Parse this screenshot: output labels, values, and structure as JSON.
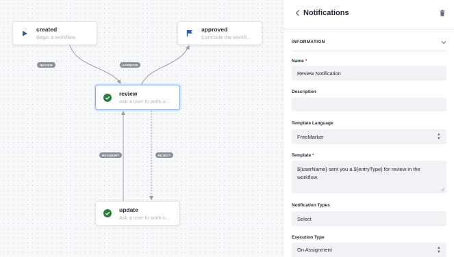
{
  "canvas": {
    "nodes": [
      {
        "id": "created",
        "title": "created",
        "description": "Begin a workflow.",
        "icon": "play-icon",
        "icon_color": "#2e5aac"
      },
      {
        "id": "approved",
        "title": "approved",
        "description": "Conclude the workfl...",
        "icon": "flag-icon",
        "icon_color": "#2e5aac"
      },
      {
        "id": "review",
        "title": "review",
        "description": "Ask a user to work o...",
        "icon": "check-circle-icon",
        "icon_color": "#287d3c"
      },
      {
        "id": "update",
        "title": "update",
        "description": "Ask a user to work o...",
        "icon": "check-circle-icon",
        "icon_color": "#287d3c"
      }
    ],
    "transitions": [
      {
        "label": "REVIEW",
        "from": "created",
        "to": "review"
      },
      {
        "label": "APPROVE",
        "from": "review",
        "to": "approved"
      },
      {
        "label": "RESUBMIT",
        "from": "update",
        "to": "review"
      },
      {
        "label": "REJECT",
        "from": "review",
        "to": "update"
      }
    ]
  },
  "panel": {
    "title": "Notifications",
    "section": "INFORMATION",
    "fields": {
      "name": {
        "label": "Name",
        "required": true,
        "value": "Review Notification"
      },
      "description": {
        "label": "Description",
        "value": ""
      },
      "template_language": {
        "label": "Template Language",
        "value": "FreeMarker"
      },
      "template": {
        "label": "Template",
        "required": true,
        "value": "${userName} sent you a ${entryType} for review in the workflow."
      },
      "notification_types": {
        "label": "Notification Types",
        "value": "Select"
      },
      "execution_type": {
        "label": "Execution Type",
        "value": "On Assignment"
      }
    }
  },
  "colors": {
    "accent_blue": "#2e5aac",
    "success_green": "#287d3c",
    "required_red": "#da1414",
    "selected_border": "#8fb2ee"
  }
}
